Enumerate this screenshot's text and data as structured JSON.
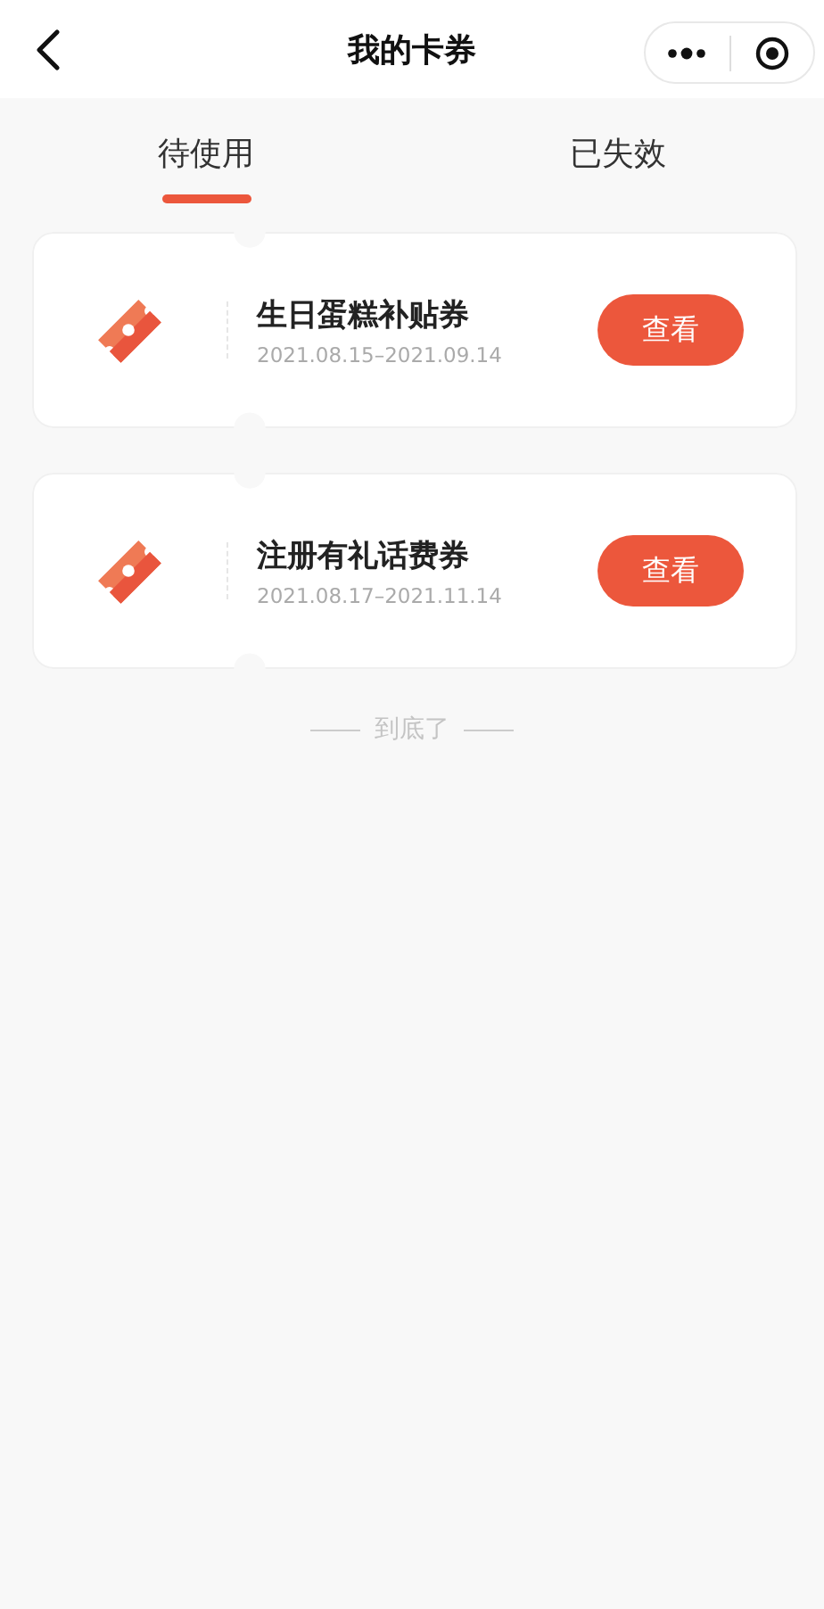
{
  "header": {
    "title": "我的卡券"
  },
  "tabs": [
    {
      "label": "待使用",
      "selected": true
    },
    {
      "label": "已失效",
      "selected": false
    }
  ],
  "coupons": [
    {
      "name": "生日蛋糕补贴券",
      "dates": "2021.08.15–2021.09.14",
      "action": "查看"
    },
    {
      "name": "注册有礼话费券",
      "dates": "2021.08.17–2021.11.14",
      "action": "查看"
    }
  ],
  "end_note": "到底了"
}
